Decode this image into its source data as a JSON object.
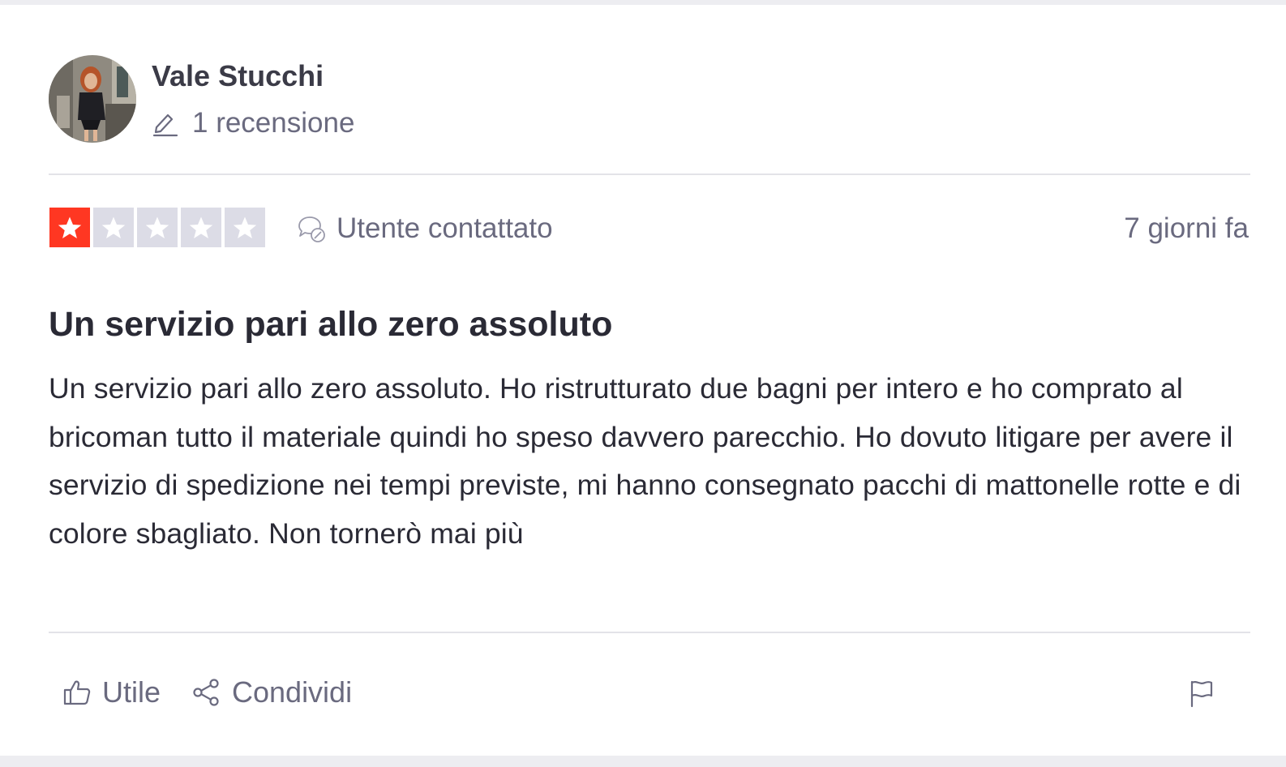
{
  "reviewer": {
    "name": "Vale Stucchi",
    "review_count": "1 recensione"
  },
  "rating": {
    "stars": 1,
    "max": 5,
    "filled_color": "#ff3722",
    "empty_color": "#dcdce6"
  },
  "status": {
    "contacted_label": "Utente contattato",
    "date": "7 giorni fa"
  },
  "review": {
    "title": "Un servizio pari allo zero assoluto",
    "body": "Un servizio pari allo zero assoluto. Ho ristrutturato due bagni per intero e ho comprato al bricoman tutto il materiale quindi ho speso davvero parecchio. Ho dovuto litigare per avere il servizio di spedizione nei tempi previste, mi hanno consegnato pacchi di mattonelle rotte e di colore sbagliato. Non tornerò mai più"
  },
  "actions": {
    "useful_label": "Utile",
    "share_label": "Condividi"
  },
  "icons": {
    "review_count": "pencil-icon",
    "contacted": "chat-bubbles-icon",
    "useful": "thumbs-up-icon",
    "share": "share-icon",
    "report": "flag-icon"
  }
}
